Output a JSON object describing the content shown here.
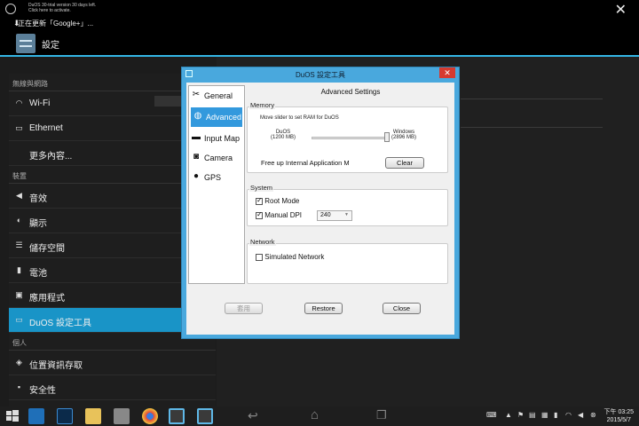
{
  "statusbar": {
    "trial_line1": "DuOS 30-trial version 30 days left.",
    "trial_line2": "Click here to activate.",
    "updating": "正在更新「Google+」..."
  },
  "header": {
    "title": "設定"
  },
  "settings": {
    "section_wireless": "無線與網路",
    "wifi": "Wi-Fi",
    "ethernet": "Ethernet",
    "more": "更多內容...",
    "section_device": "裝置",
    "sound": "音效",
    "display": "顯示",
    "storage": "儲存空間",
    "battery": "電池",
    "apps": "應用程式",
    "duos": "DuOS 設定工具",
    "section_personal": "個人",
    "location": "位置資訊存取",
    "security": "安全性"
  },
  "dialog": {
    "title": "DuOS 設定工具",
    "nav": [
      "General",
      "Advanced",
      "Input Map",
      "Camera",
      "GPS"
    ],
    "content_title": "Advanced Settings",
    "memory": {
      "label": "Memory",
      "hint": "Move slider to set RAM for DuOS",
      "left_label": "DuOS",
      "left_value": "(1200 MB)",
      "right_label": "Windows",
      "right_value": "(2896 MB)",
      "slider_fraction": 0.99,
      "free_text": "Free up Internal Application M",
      "clear": "Clear"
    },
    "system": {
      "label": "System",
      "root_mode": "Root Mode",
      "root_checked": true,
      "manual_dpi": "Manual DPI",
      "dpi_checked": true,
      "dpi_value": "240"
    },
    "network": {
      "label": "Network",
      "simulated": "Simulated Network",
      "simulated_checked": false
    },
    "buttons": {
      "apply": "套用",
      "restore": "Restore",
      "close": "Close"
    }
  },
  "taskbar": {
    "time": "下午 03:25",
    "date": "2015/5/7"
  }
}
